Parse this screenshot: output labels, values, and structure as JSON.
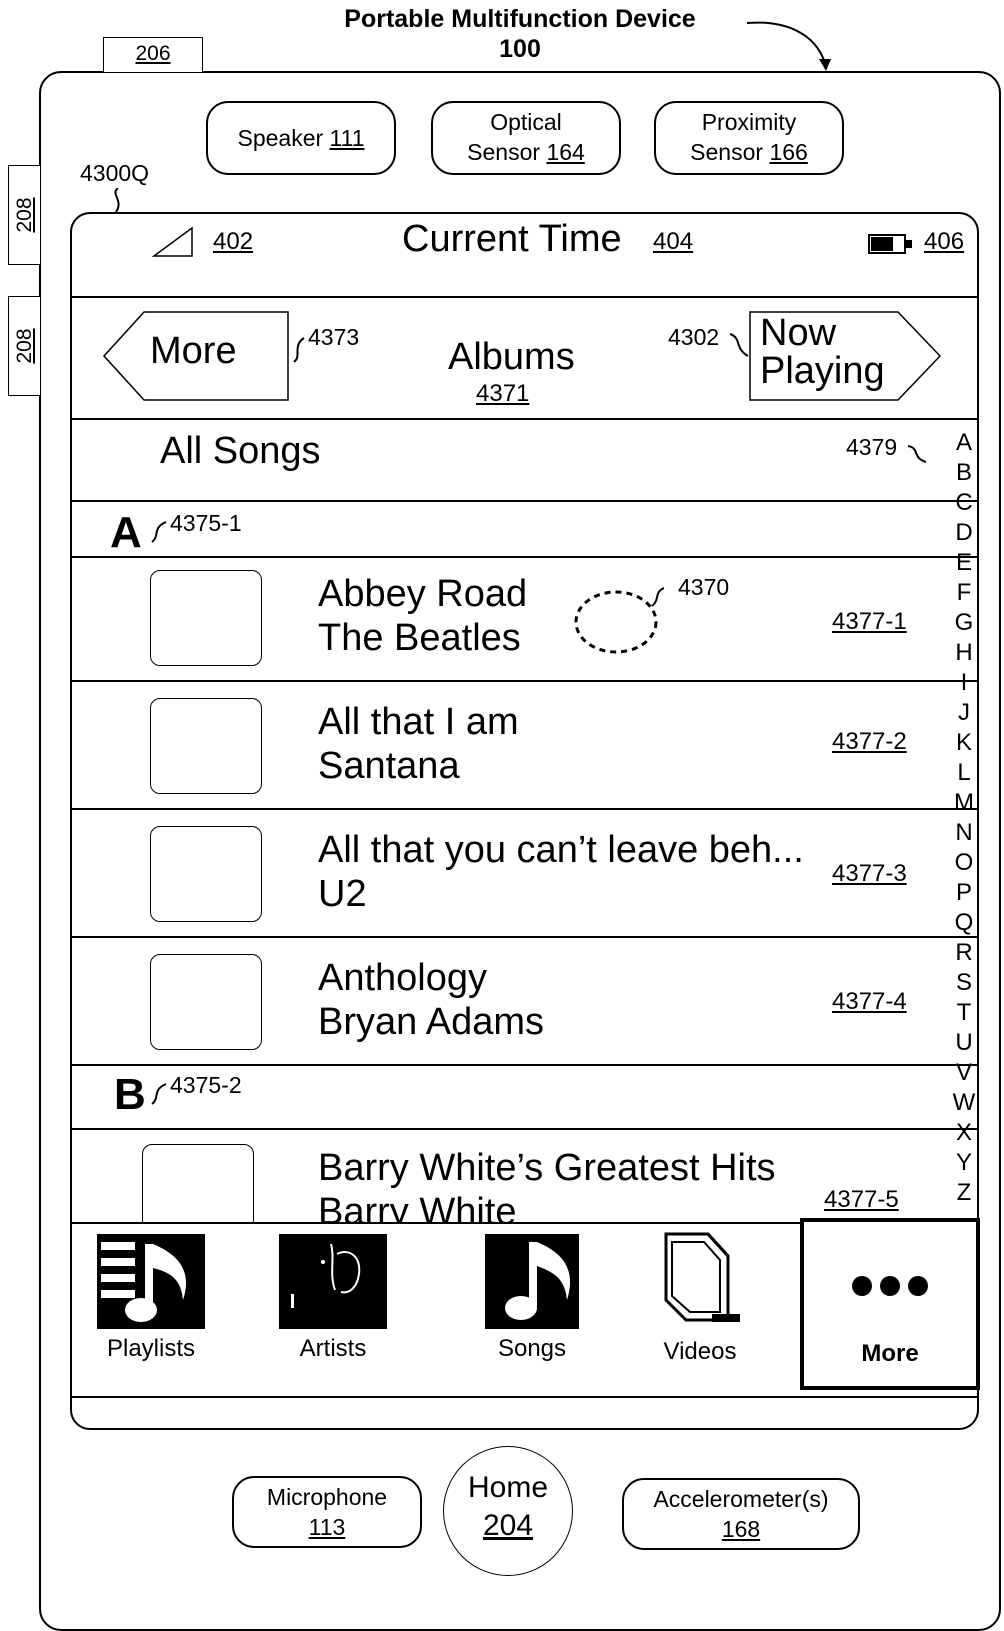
{
  "device": {
    "title": "Portable Multifunction Device",
    "number": "100"
  },
  "side_buttons": {
    "top": "206",
    "left_a": "208",
    "left_b": "208"
  },
  "sensors": {
    "speaker_label": "Speaker",
    "speaker_num": "111",
    "optical_label": "Optical",
    "optical_label2": "Sensor",
    "optical_num": "164",
    "proximity_label": "Proximity",
    "proximity_label2": "Sensor",
    "proximity_num": "166"
  },
  "screen_ref": "4300Q",
  "status_bar": {
    "signal_ref": "402",
    "time_label": "Current Time",
    "time_ref": "404",
    "battery_ref": "406"
  },
  "nav_bar": {
    "back_label": "More",
    "back_ref": "4373",
    "title": "Albums",
    "title_ref": "4371",
    "forward_ref": "4302",
    "forward_label_1": "Now",
    "forward_label_2": "Playing"
  },
  "all_songs": {
    "label": "All Songs",
    "index_ref": "4379"
  },
  "sections": [
    {
      "letter": "A",
      "ref": "4375-1"
    },
    {
      "letter": "B",
      "ref": "4375-2"
    }
  ],
  "contact_ref": "4370",
  "albums": [
    {
      "title": "Abbey Road",
      "artist": "The Beatles",
      "ref": "4377-1"
    },
    {
      "title": "All that I am",
      "artist": "Santana",
      "ref": "4377-2"
    },
    {
      "title": "All that you can’t leave beh...",
      "artist": "U2",
      "ref": "4377-3"
    },
    {
      "title": "Anthology",
      "artist": "Bryan Adams",
      "ref": "4377-4"
    },
    {
      "title": "Barry White’s Greatest Hits",
      "artist": "Barry White",
      "ref": "4377-5"
    }
  ],
  "index_letters": [
    "A",
    "B",
    "C",
    "D",
    "E",
    "F",
    "G",
    "H",
    "I",
    "J",
    "K",
    "L",
    "M",
    "N",
    "O",
    "P",
    "Q",
    "R",
    "S",
    "T",
    "U",
    "V",
    "W",
    "X",
    "Y",
    "Z"
  ],
  "tab_bar": [
    {
      "label": "Playlists",
      "icon": "playlist-icon"
    },
    {
      "label": "Artists",
      "icon": "artist-icon"
    },
    {
      "label": "Songs",
      "icon": "music-note-icon"
    },
    {
      "label": "Videos",
      "icon": "tv-icon"
    },
    {
      "label": "More",
      "icon": "more-dots-icon"
    }
  ],
  "bottom": {
    "microphone_label": "Microphone",
    "microphone_num": "113",
    "home_label": "Home",
    "home_num": "204",
    "accel_label": "Accelerometer(s)",
    "accel_num": "168"
  }
}
